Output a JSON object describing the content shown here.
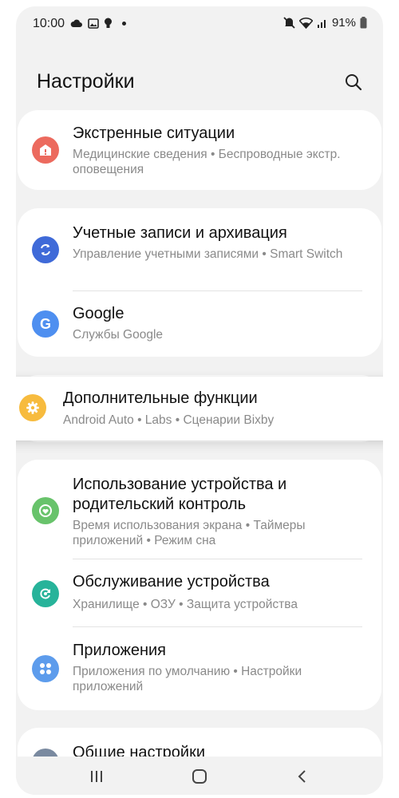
{
  "status_bar": {
    "time": "10:00",
    "battery": "91%",
    "left_icons": [
      "cloud-icon",
      "image-icon",
      "bulb-icon",
      "dot-icon"
    ],
    "right_icons": [
      "mute-icon",
      "wifi-icon",
      "signal-icon",
      "battery-icon"
    ]
  },
  "header": {
    "title": "Настройки",
    "search_icon": "search-icon"
  },
  "colors": {
    "emergency": "#ec6a5e",
    "accounts": "#3f6ad8",
    "google": "#4e8ff0",
    "advanced": "#f7bb3e",
    "wellbeing": "#68c36b",
    "device_care": "#27b39a",
    "apps": "#5d9cec",
    "general": "#7a8aa0"
  },
  "items": [
    {
      "title": "Экстренные ситуации",
      "sub": "Медицинские сведения  •  Беспроводные экстр. оповещения",
      "icon": "emergency-icon"
    },
    {
      "title": "Учетные записи и архивация",
      "sub": "Управление учетными записями  •  Smart Switch",
      "icon": "sync-icon"
    },
    {
      "title": "Google",
      "sub": "Службы Google",
      "icon": "google-icon"
    },
    {
      "title": "Дополнительные функции",
      "sub": "Android Auto  •  Labs  •  Сценарии Bixby",
      "icon": "gear-plus-icon"
    },
    {
      "title": "Использование устройства и родительский контроль",
      "sub": "Время использования экрана  •  Таймеры приложений  •  Режим сна",
      "icon": "heart-circle-icon"
    },
    {
      "title": "Обслуживание устройства",
      "sub": "Хранилище  •  ОЗУ  •  Защита устройства",
      "icon": "refresh-icon"
    },
    {
      "title": "Приложения",
      "sub": "Приложения по умолчанию  •  Настройки приложений",
      "icon": "apps-grid-icon"
    },
    {
      "title": "Общие настройки",
      "sub": "",
      "icon": "general-settings-icon"
    }
  ],
  "nav": {
    "recents_icon": "recents-icon",
    "home_icon": "home-icon",
    "back_icon": "back-icon"
  }
}
